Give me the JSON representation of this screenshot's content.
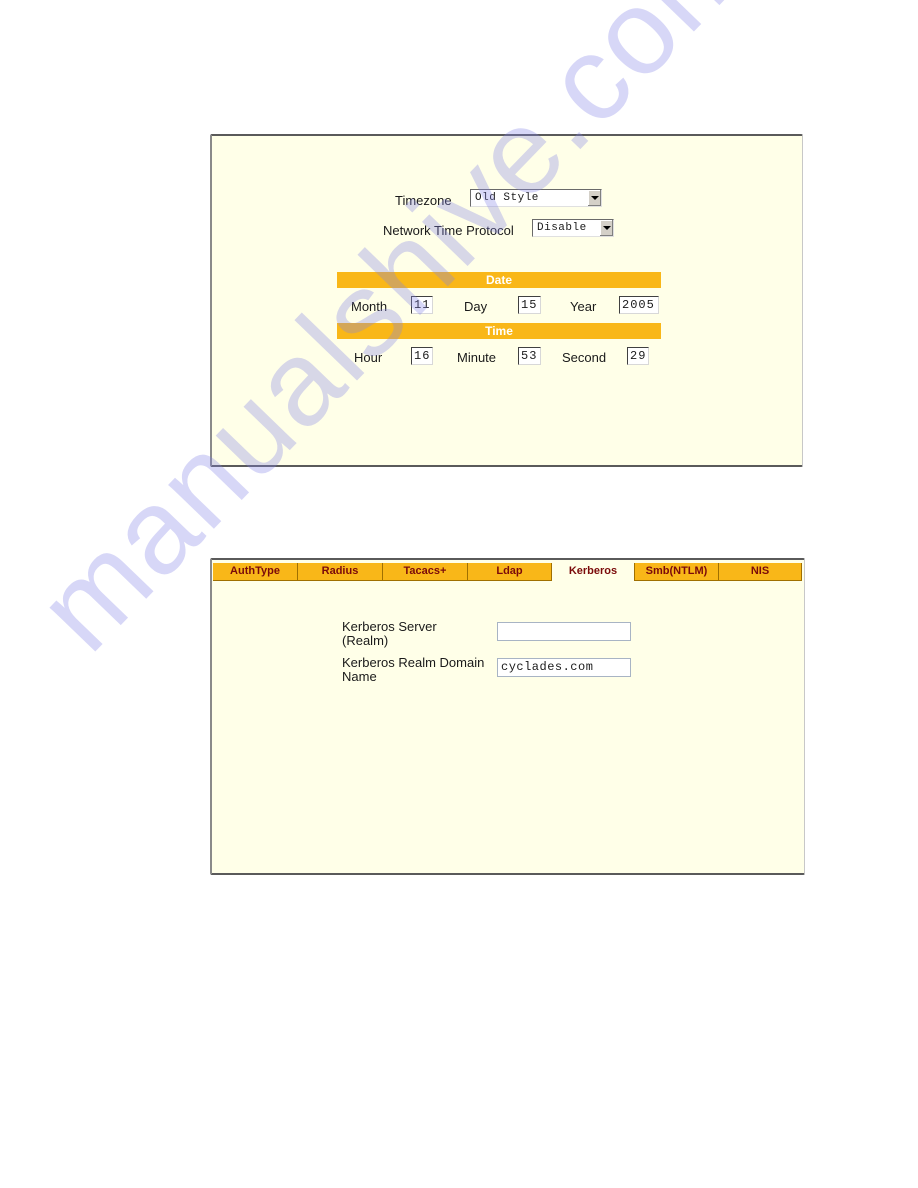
{
  "datetime_panel": {
    "timezone": {
      "label": "Timezone",
      "selected": "Old Style"
    },
    "ntp": {
      "label": "Network Time Protocol",
      "selected": "Disable"
    },
    "date": {
      "header": "Date",
      "month_label": "Month",
      "month_value": "11",
      "day_label": "Day",
      "day_value": "15",
      "year_label": "Year",
      "year_value": "2005"
    },
    "time": {
      "header": "Time",
      "hour_label": "Hour",
      "hour_value": "16",
      "minute_label": "Minute",
      "minute_value": "53",
      "second_label": "Second",
      "second_value": "29"
    }
  },
  "auth_panel": {
    "tabs": [
      {
        "label": "AuthType",
        "active": false
      },
      {
        "label": "Radius",
        "active": false
      },
      {
        "label": "Tacacs+",
        "active": false
      },
      {
        "label": "Ldap",
        "active": false
      },
      {
        "label": "Kerberos",
        "active": true
      },
      {
        "label": "Smb(NTLM)",
        "active": false
      },
      {
        "label": "NIS",
        "active": false
      }
    ],
    "kerberos_server": {
      "label_line1": "Kerberos Server",
      "label_line2": "(Realm)",
      "value": ""
    },
    "kerberos_realm_domain": {
      "label_line1": "Kerberos Realm Domain",
      "label_line2": "Name",
      "value": "cyclades.com"
    }
  },
  "watermark": "manualshive.com",
  "colors": {
    "panel_bg": "#ffffe8",
    "accent_bar": "#f9b718",
    "tab_text": "#7a0a0a",
    "watermark": "#8282e6"
  }
}
